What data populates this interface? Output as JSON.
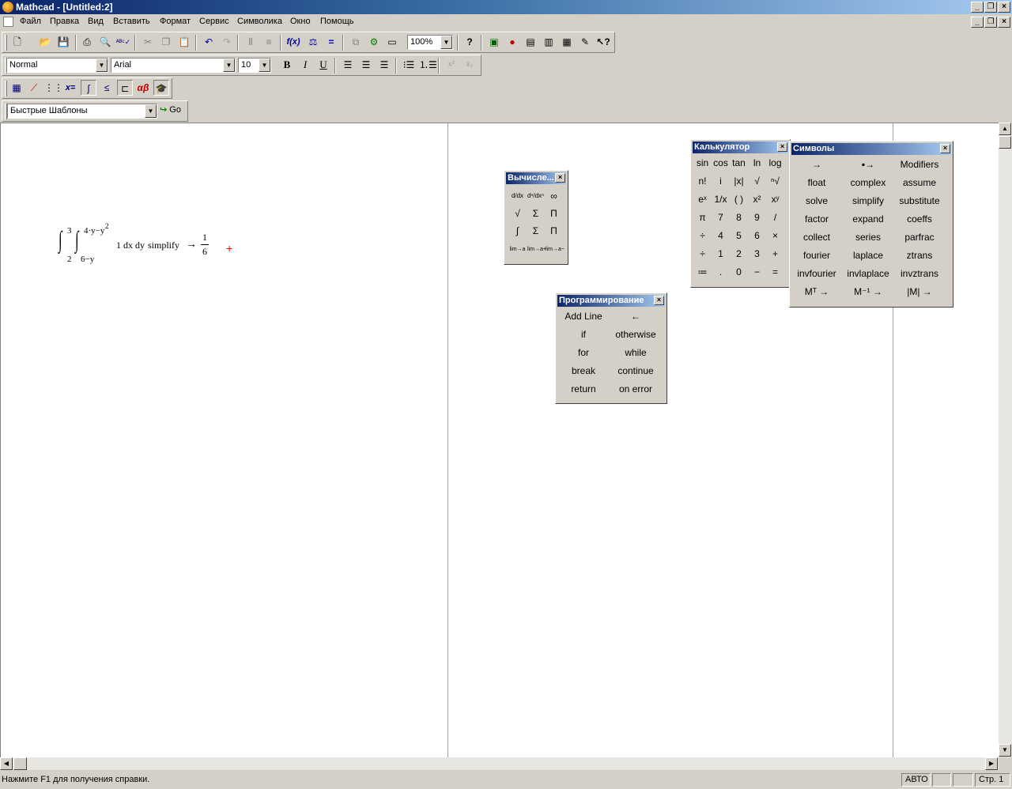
{
  "window": {
    "title": "Mathcad - [Untitled:2]"
  },
  "menu": [
    "Файл",
    "Правка",
    "Вид",
    "Вставить",
    "Формат",
    "Сервис",
    "Символика",
    "Окно",
    "Помощь"
  ],
  "toolbar": {
    "zoom": "100%"
  },
  "format_bar": {
    "style": "Normal",
    "font": "Arial",
    "size": "10",
    "bold": "B",
    "italic": "I",
    "underline": "U"
  },
  "math_bar": {
    "eval_label": "x=",
    "greek_label": "αβ"
  },
  "templates": {
    "selected": "Быстрые Шаблоны",
    "go_label": "Go"
  },
  "worksheet": {
    "lower1": "2",
    "upper1": "3",
    "lower2": "6−y",
    "upper2": "4·y−y",
    "upper2_exp": "2",
    "integrand": "1 dx dy",
    "keyword": "simplify",
    "arrow": "→",
    "num": "1",
    "den": "6",
    "cursor": "+"
  },
  "calc_palette": {
    "title": "Вычисле...",
    "rows": [
      [
        "d/dx",
        "dⁿ/dxⁿ",
        "∞"
      ],
      [
        "√",
        "Σ",
        "Π"
      ],
      [
        "∫",
        "Σ",
        "Π"
      ],
      [
        "lim→a",
        "lim→a+",
        "lim→a−"
      ]
    ]
  },
  "calculator": {
    "title": "Калькулятор",
    "rows": [
      [
        "sin",
        "cos",
        "tan",
        "ln",
        "log"
      ],
      [
        "n!",
        "i",
        "|x|",
        "√",
        "ⁿ√"
      ],
      [
        "eˣ",
        "1/x",
        "( )",
        "x²",
        "xʸ"
      ],
      [
        "π",
        "7",
        "8",
        "9",
        "/"
      ],
      [
        "÷",
        "4",
        "5",
        "6",
        "×"
      ],
      [
        "÷",
        "1",
        "2",
        "3",
        "+"
      ],
      [
        "≔",
        ".",
        "0",
        "−",
        "="
      ]
    ]
  },
  "symbols": {
    "title": "Символы",
    "rows": [
      [
        "→",
        "▪→",
        "Modifiers"
      ],
      [
        "float",
        "complex",
        "assume"
      ],
      [
        "solve",
        "simplify",
        "substitute"
      ],
      [
        "factor",
        "expand",
        "coeffs"
      ],
      [
        "collect",
        "series",
        "parfrac"
      ],
      [
        "fourier",
        "laplace",
        "ztrans"
      ],
      [
        "invfourier",
        "invlaplace",
        "invztrans"
      ],
      [
        "Mᵀ →",
        "M⁻¹ →",
        "|M| →"
      ]
    ]
  },
  "programming": {
    "title": "Программирование",
    "rows": [
      [
        "Add Line",
        "←"
      ],
      [
        "if",
        "otherwise"
      ],
      [
        "for",
        "while"
      ],
      [
        "break",
        "continue"
      ],
      [
        "return",
        "on error"
      ]
    ]
  },
  "status": {
    "help": "Нажмите F1 для получения справки.",
    "mode": "АВТО",
    "page": "Стр. 1"
  }
}
